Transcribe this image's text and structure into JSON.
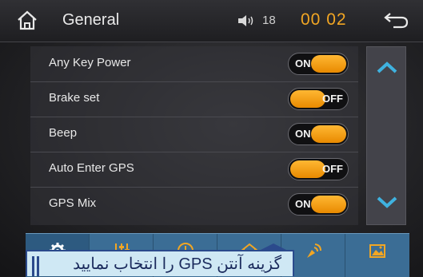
{
  "header": {
    "title": "General",
    "volume_icon": "speaker-icon",
    "volume_level": "18",
    "clock": "00 02",
    "back_icon": "back-arrow-icon",
    "home_icon": "home-icon"
  },
  "settings": [
    {
      "label": "Any Key Power",
      "state": "ON"
    },
    {
      "label": "Brake set",
      "state": "OFF"
    },
    {
      "label": "Beep",
      "state": "ON"
    },
    {
      "label": "Auto Enter GPS",
      "state": "OFF"
    },
    {
      "label": "GPS Mix",
      "state": "ON"
    }
  ],
  "scroll": {
    "up_icon": "chevron-up-icon",
    "down_icon": "chevron-down-icon"
  },
  "tabs": [
    {
      "icon": "gear-icon"
    },
    {
      "icon": "equalizer-icon"
    },
    {
      "icon": "clock-icon"
    },
    {
      "icon": "home-settings-icon"
    },
    {
      "icon": "satellite-icon"
    },
    {
      "icon": "picture-icon"
    }
  ],
  "caption": {
    "text": "گزینه آنتن GPS را انتخاب نمایید"
  },
  "colors": {
    "accent": "#f2a623",
    "tabbar": "#3b6d95",
    "caption_bg": "#cfe8f4"
  }
}
